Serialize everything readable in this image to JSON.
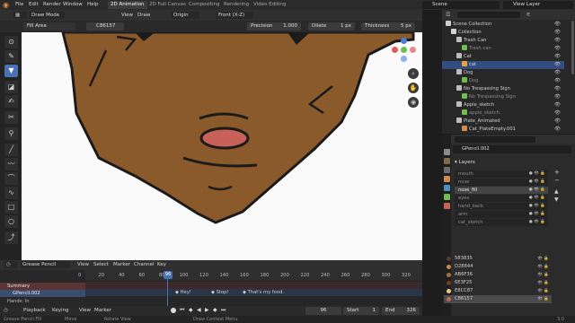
{
  "menu": {
    "items": [
      "File",
      "Edit",
      "Render",
      "Window",
      "Help"
    ],
    "workspaces": [
      "2D Animation",
      "2D Full Canvas",
      "Compositing",
      "Rendering",
      "Video Editing"
    ],
    "scene": "Scene",
    "view_layer": "View Layer"
  },
  "viewport_header": {
    "mode": "Draw Mode",
    "menus": [
      "View",
      "Draw"
    ],
    "origin": "Origin",
    "view": "Front (X-Z)"
  },
  "tool_settings": {
    "tool": "Fill Area",
    "color_hex": "C86157",
    "precision_label": "Precision",
    "precision_value": "1.000",
    "dilate_label": "Dilate",
    "dilate_value": "1 px",
    "thickness_label": "Thickness",
    "thickness_value": "5 px"
  },
  "outliner": {
    "rows": [
      {
        "label": "Scene Collection",
        "indent": 0,
        "state": "normal"
      },
      {
        "label": "Collection",
        "indent": 1,
        "state": "normal"
      },
      {
        "label": "Trash Can",
        "indent": 2,
        "state": "normal"
      },
      {
        "label": "Trash can",
        "indent": 3,
        "state": "dim"
      },
      {
        "label": "Cat",
        "indent": 2,
        "state": "normal"
      },
      {
        "label": "cat",
        "indent": 3,
        "state": "sel"
      },
      {
        "label": "Dog",
        "indent": 2,
        "state": "normal"
      },
      {
        "label": "Dog",
        "indent": 3,
        "state": "dim"
      },
      {
        "label": "No Trespassing Sign",
        "indent": 2,
        "state": "normal"
      },
      {
        "label": "No Trespassing Sign",
        "indent": 3,
        "state": "dim"
      },
      {
        "label": "Apple_sketch",
        "indent": 2,
        "state": "normal"
      },
      {
        "label": "apple_sketch",
        "indent": 3,
        "state": "dim"
      },
      {
        "label": "Plate_Animated",
        "indent": 2,
        "state": "normal"
      },
      {
        "label": "Cat_PlateEmpty.001",
        "indent": 3,
        "state": "normal"
      }
    ]
  },
  "properties": {
    "object_name": "GPencil.002",
    "layers_title": "Layers",
    "layers": [
      "mouth",
      "nose",
      "nose_fill",
      "eyes",
      "hand_back",
      "arm",
      "cat_sketch"
    ],
    "active_layer": "nose_fill",
    "materials": [
      {
        "name": "583835",
        "color": "#583835"
      },
      {
        "name": "D28844",
        "color": "#D28844"
      },
      {
        "name": "AB6F36",
        "color": "#AB6F36"
      },
      {
        "name": "6E3F25",
        "color": "#6E3F25"
      },
      {
        "name": "E8CC87",
        "color": "#E8CC87"
      },
      {
        "name": "C86157",
        "color": "#C86157"
      }
    ],
    "active_material": "C86157"
  },
  "timeline": {
    "mode": "Grease Pencil",
    "menus": [
      "View",
      "Select",
      "Marker",
      "Channel",
      "Key"
    ],
    "ticks": [
      "0",
      "20",
      "40",
      "60",
      "80",
      "100",
      "120",
      "140",
      "160",
      "180",
      "200",
      "220",
      "240",
      "260",
      "280",
      "300",
      "320"
    ],
    "current_frame": "96",
    "channels": [
      "Summary",
      "GPencil.002",
      "Hands: In"
    ],
    "markers": [
      "Hey!",
      "Stop!",
      "That's my food."
    ],
    "playback": "Playback",
    "keying": "Keying",
    "view": "View",
    "marker": "Marker",
    "frame": "96",
    "start_label": "Start",
    "start": "1",
    "end_label": "End",
    "end": "326"
  },
  "statusbar": {
    "left": "Grease Pencil Fill",
    "move": "Move",
    "rotate": "Rotate View",
    "context": "Draw Context Menu",
    "version": "3.0"
  },
  "colors": {
    "fur": "#8B5A2B",
    "nose": "#C86157",
    "accent": "#4772B3"
  }
}
